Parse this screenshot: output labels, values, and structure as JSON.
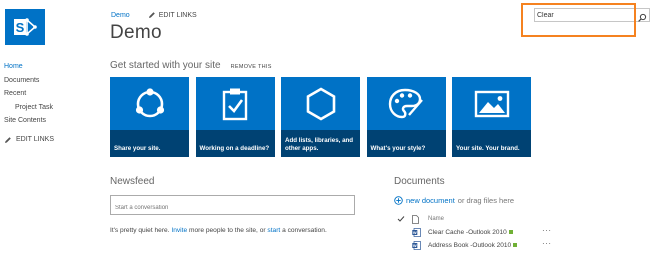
{
  "header": {
    "site_link": "Demo",
    "edit_links": "EDIT LINKS",
    "site_title": "Demo"
  },
  "search": {
    "value": "Clear",
    "icon": "search-icon"
  },
  "quick_launch": {
    "items": [
      {
        "label": "Home"
      },
      {
        "label": "Documents"
      },
      {
        "label": "Recent"
      },
      {
        "label": "Project Task"
      },
      {
        "label": "Site Contents"
      }
    ],
    "edit_links": "EDIT LINKS"
  },
  "get_started": {
    "title": "Get started with your site",
    "remove": "REMOVE THIS",
    "tiles": [
      {
        "label": "Share your site.",
        "icon": "share-icon"
      },
      {
        "label": "Working on a deadline?",
        "icon": "clipboard-check-icon"
      },
      {
        "label": "Add lists, libraries, and other apps.",
        "icon": "hexagon-icon"
      },
      {
        "label": "What's your style?",
        "icon": "palette-icon"
      },
      {
        "label": "Your site. Your brand.",
        "icon": "image-icon"
      }
    ],
    "tile_color": "#0072c6"
  },
  "newsfeed": {
    "title": "Newsfeed",
    "placeholder": "Start a conversation",
    "msg_pre": "It's pretty quiet here. ",
    "msg_invite": "Invite",
    "msg_mid": " more people to the site, or ",
    "msg_start": "start",
    "msg_post": " a conversation."
  },
  "documents": {
    "title": "Documents",
    "new_document": "new document",
    "drag_text": "or drag files here",
    "column_name": "Name",
    "files": [
      {
        "name": "Clear Cache -Outlook 2010"
      },
      {
        "name": "Address Book -Outlook 2010"
      }
    ],
    "more": "···"
  },
  "colors": {
    "accent": "#0072c6",
    "highlight": "#f58220",
    "new_badge": "#70b035"
  }
}
